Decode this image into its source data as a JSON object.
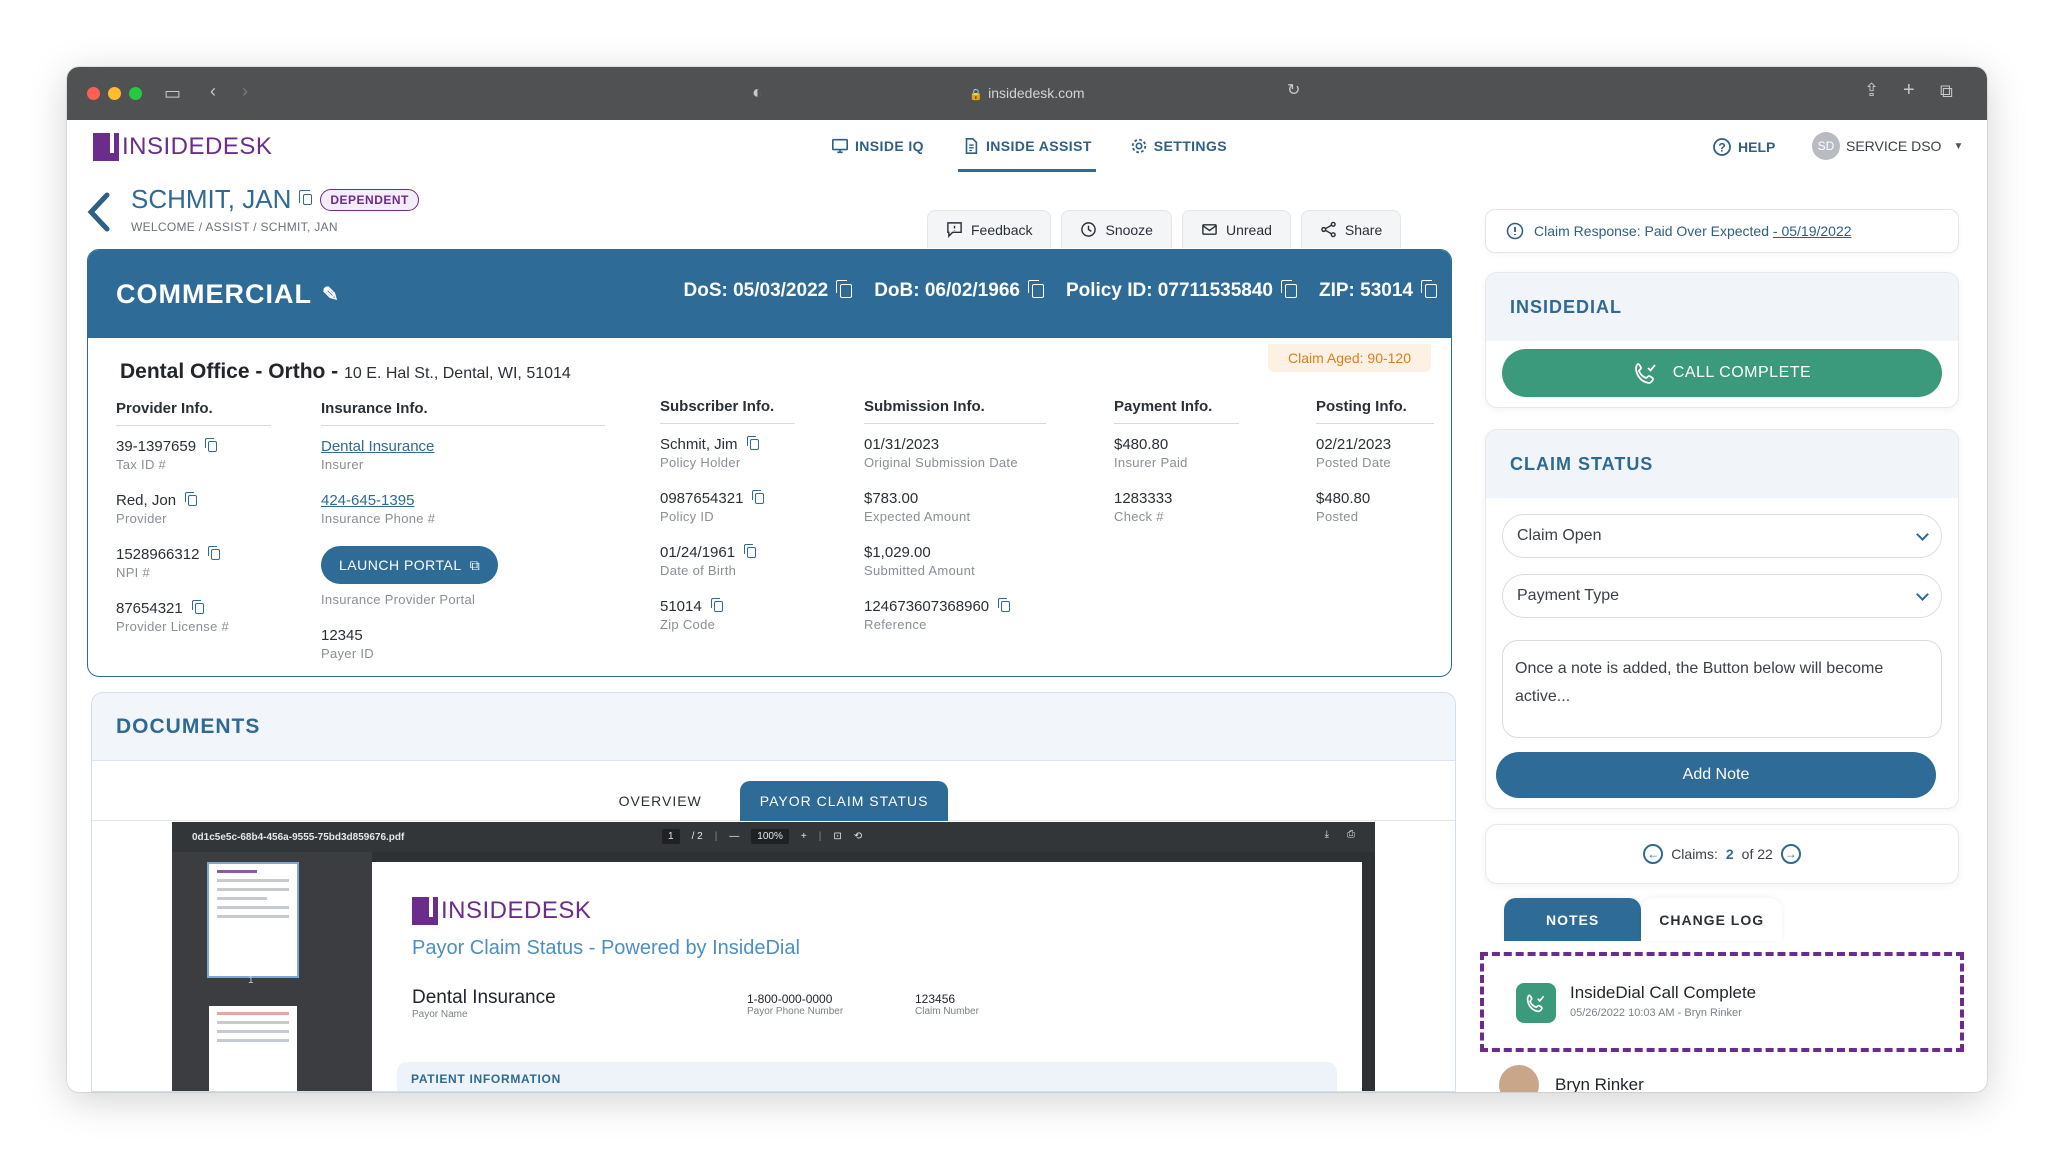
{
  "browser": {
    "url": "insidedesk.com"
  },
  "app": {
    "logo_text": "INSIDEDESK",
    "nav": [
      {
        "label": "INSIDE IQ",
        "icon": "monitor-icon",
        "active": false
      },
      {
        "label": "INSIDE ASSIST",
        "icon": "document-icon",
        "active": true
      },
      {
        "label": "SETTINGS",
        "icon": "gear-icon",
        "active": false
      }
    ],
    "help_label": "HELP",
    "user": {
      "initials": "SD",
      "name": "SERVICE DSO"
    }
  },
  "patient": {
    "name": "SCHMIT, JAN",
    "badge": "DEPENDENT",
    "breadcrumb": "WELCOME  / ASSIST / SCHMIT, JAN"
  },
  "actions": [
    {
      "label": "Feedback",
      "icon": "feedback-icon"
    },
    {
      "label": "Snooze",
      "icon": "clock-icon"
    },
    {
      "label": "Unread",
      "icon": "mail-icon"
    },
    {
      "label": "Share",
      "icon": "share-icon"
    }
  ],
  "claim": {
    "type": "COMMERCIAL",
    "dos": "DoS: 05/03/2022",
    "dob": "DoB: 06/02/1966",
    "policy": "Policy ID: 07711535840",
    "zip": "ZIP: 53014",
    "aged": "Claim Aged: 90-120",
    "office_name": "Dental Office - Ortho -",
    "office_address": "10 E. Hal St., Dental, WI, 51014",
    "provider": {
      "header": "Provider Info.",
      "fields": [
        {
          "value": "39-1397659",
          "label": "Tax ID #"
        },
        {
          "value": "Red, Jon",
          "label": "Provider"
        },
        {
          "value": "1528966312",
          "label": "NPI #"
        },
        {
          "value": "87654321",
          "label": "Provider License #"
        }
      ]
    },
    "insurance": {
      "header": "Insurance Info.",
      "insurer": "Dental Insurance",
      "insurer_label": "Insurer",
      "phone": "424-645-1395",
      "phone_label": "Insurance Phone #",
      "portal_button": "LAUNCH PORTAL",
      "portal_label": "Insurance Provider Portal",
      "payer_id": "12345",
      "payer_id_label": "Payer ID"
    },
    "subscriber": {
      "header": "Subscriber Info.",
      "fields": [
        {
          "value": "Schmit, Jim",
          "label": "Policy Holder"
        },
        {
          "value": "0987654321",
          "label": "Policy ID"
        },
        {
          "value": "01/24/1961",
          "label": "Date of Birth"
        },
        {
          "value": "51014",
          "label": "Zip Code"
        }
      ]
    },
    "submission": {
      "header": "Submission Info.",
      "fields": [
        {
          "value": "01/31/2023",
          "label": "Original Submission Date"
        },
        {
          "value": "$783.00",
          "label": "Expected Amount"
        },
        {
          "value": "$1,029.00",
          "label": "Submitted Amount"
        },
        {
          "value": "124673607368960",
          "label": "Reference"
        }
      ]
    },
    "payment": {
      "header": "Payment Info.",
      "fields": [
        {
          "value": "$480.80",
          "label": "Insurer Paid"
        },
        {
          "value": "1283333",
          "label": "Check #"
        }
      ]
    },
    "posting": {
      "header": "Posting Info.",
      "fields": [
        {
          "value": "02/21/2023",
          "label": "Posted Date"
        },
        {
          "value": "$480.80",
          "label": "Posted"
        }
      ]
    }
  },
  "documents": {
    "title": "DOCUMENTS",
    "tabs": [
      {
        "label": "OVERVIEW",
        "active": false
      },
      {
        "label": "PAYOR CLAIM STATUS",
        "active": true
      }
    ],
    "viewer": {
      "filename": "0d1c5e5c-68b4-456a-9555-75bd3d859676.pdf",
      "page": "1",
      "pages": "/ 2",
      "zoom": "100%",
      "thumb_num": "1"
    },
    "pdf": {
      "logo": "INSIDEDESK",
      "subtitle": "Payor Claim Status - Powered by InsideDial",
      "payor_name": "Dental Insurance",
      "payor_name_label": "Payor Name",
      "payor_phone": "1-800-000-0000",
      "payor_phone_label": "Payor Phone Number",
      "claim_number": "123456",
      "claim_number_label": "Claim Number",
      "section": "PATIENT INFORMATION"
    }
  },
  "sidebar": {
    "claim_response_text": "Claim Response: Paid Over Expected",
    "claim_response_date": "- 05/19/2022",
    "insidedial_title": "INSIDEDIAL",
    "call_button": "CALL COMPLETE",
    "claim_status_title": "CLAIM STATUS",
    "status_select": "Claim Open",
    "payment_select": "Payment Type",
    "note_placeholder": "Once a note is added, the Button below will become active...",
    "add_note": "Add Note",
    "claims_label": "Claims:",
    "claims_current": "2",
    "claims_total": "of 22",
    "note_tabs": [
      {
        "label": "NOTES",
        "active": true
      },
      {
        "label": "CHANGE LOG",
        "active": false
      }
    ],
    "notes": [
      {
        "title": "InsideDial Call Complete",
        "meta": "05/26/2022 10:03 AM - Bryn Rinker"
      },
      {
        "title": "Bryn Rinker"
      }
    ]
  }
}
